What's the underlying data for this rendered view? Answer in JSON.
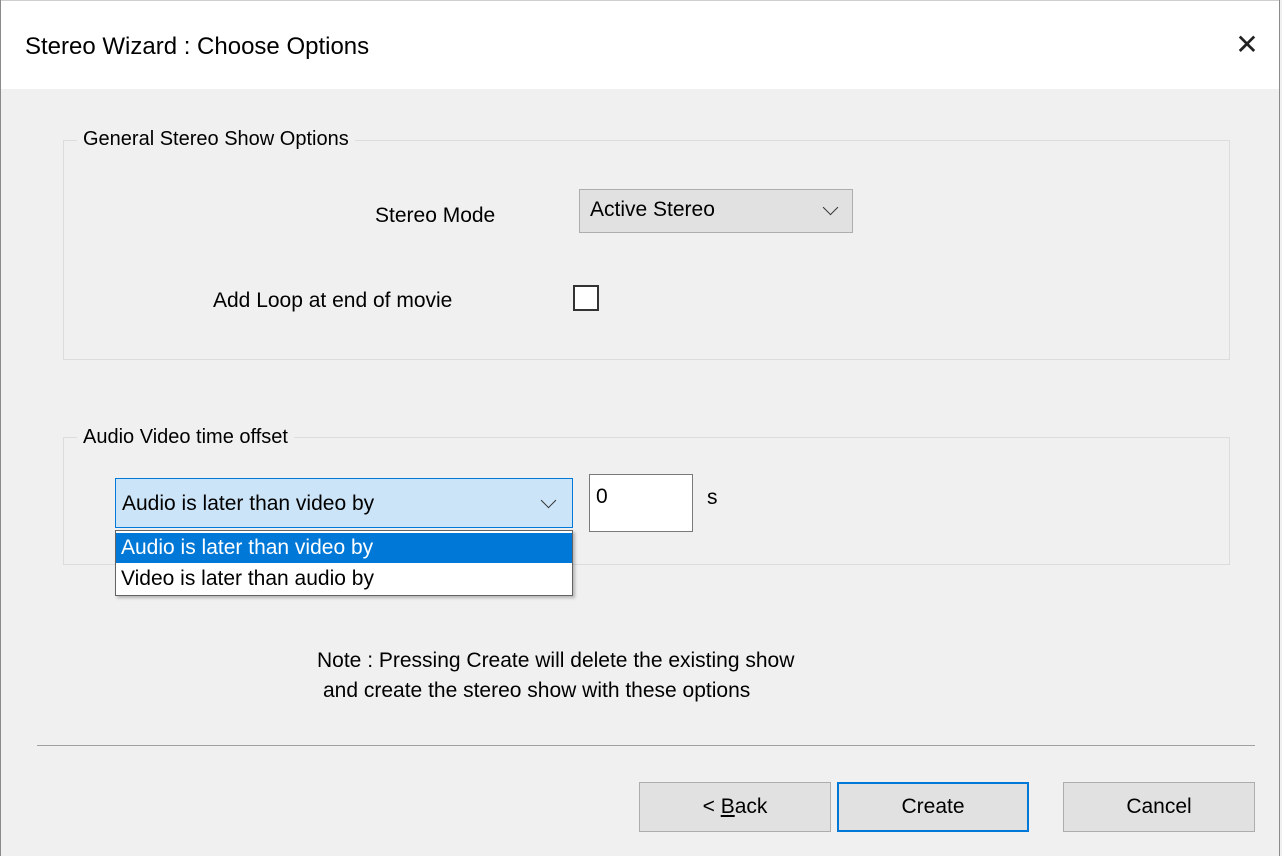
{
  "window": {
    "title": "Stereo Wizard : Choose Options",
    "close_glyph": "✕"
  },
  "general_group": {
    "label": "General Stereo Show Options",
    "stereo_mode_label": "Stereo Mode",
    "stereo_mode_value": "Active Stereo",
    "add_loop_label": "Add Loop at end of movie",
    "add_loop_checked": false
  },
  "av_group": {
    "label": "Audio Video time offset",
    "direction_value": "Audio is later than video by",
    "offset_value": "0",
    "unit": "s",
    "options": [
      "Audio is later than video by",
      "Video is later than audio by"
    ],
    "selected_option_index": 0
  },
  "note": {
    "line1": "Note : Pressing Create will delete the existing show",
    "line2": "and create the stereo show with these options"
  },
  "buttons": {
    "back_prefix": "< ",
    "back_mnemonic": "B",
    "back_rest": "ack",
    "create": "Create",
    "cancel": "Cancel"
  },
  "colors": {
    "selection": "#0078d7",
    "default_button_border": "#0078d7"
  }
}
